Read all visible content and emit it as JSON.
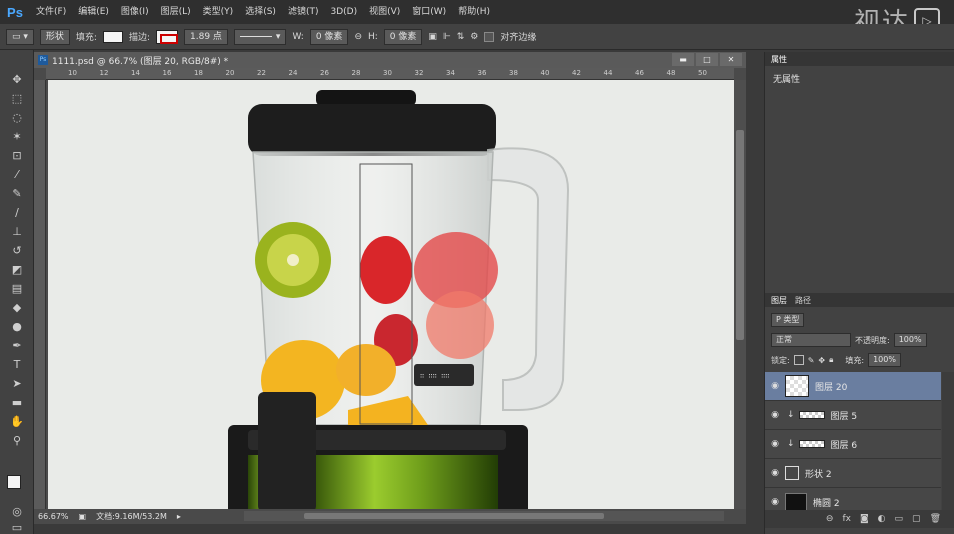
{
  "app": {
    "logo": "Ps"
  },
  "menus": [
    "文件(F)",
    "编辑(E)",
    "图像(I)",
    "图层(L)",
    "类型(Y)",
    "选择(S)",
    "滤镜(T)",
    "3D(D)",
    "视图(V)",
    "窗口(W)",
    "帮助(H)"
  ],
  "watermark": {
    "text": "视达",
    "logo": "▷"
  },
  "options": {
    "mode": "形状",
    "fill_label": "填充:",
    "stroke_label": "描边:",
    "stroke_width": "1.89 点",
    "w_label": "W:",
    "w_value": "0 像素",
    "link_icon": "⊖",
    "h_label": "H:",
    "h_value": "0 像素",
    "align_edges": "对齐边缘"
  },
  "document": {
    "tab_title": "1111.psd @ 66.7% (图层 20, RGB/8#) *",
    "zoom": "66.67%",
    "doc_info": "文档:9.16M/53.2M",
    "ruler_marks": [
      "10",
      "12",
      "14",
      "16",
      "18",
      "20",
      "22",
      "24",
      "26",
      "28",
      "30",
      "32",
      "34",
      "36",
      "38",
      "40",
      "42",
      "44",
      "46",
      "48",
      "50"
    ]
  },
  "properties": {
    "tab": "属性",
    "content": "无属性"
  },
  "layers": {
    "tabs": [
      "图层",
      "路径"
    ],
    "filter_kind": "P 类型",
    "blend_mode": "正常",
    "opacity_label": "不透明度:",
    "opacity_value": "100%",
    "lock_label": "锁定:",
    "fill_label": "填充:",
    "fill_value": "100%",
    "items": [
      {
        "name": "图层 20",
        "selected": true,
        "type": "pixel"
      },
      {
        "name": "图层 5",
        "selected": false,
        "type": "clipped"
      },
      {
        "name": "图层 6",
        "selected": false,
        "type": "clipped"
      },
      {
        "name": "形状 2",
        "selected": false,
        "type": "shape"
      },
      {
        "name": "椭圆 2",
        "selected": false,
        "type": "ellipse"
      }
    ]
  },
  "footer_icons": [
    "link-icon",
    "fx-icon",
    "mask-icon",
    "adjustment-icon",
    "folder-icon",
    "new-layer-icon",
    "trash-icon"
  ],
  "colors": {
    "accent": "#6a7ea0",
    "canvas_bg": "#e9ebe8",
    "blender_green": "#7aa626"
  }
}
